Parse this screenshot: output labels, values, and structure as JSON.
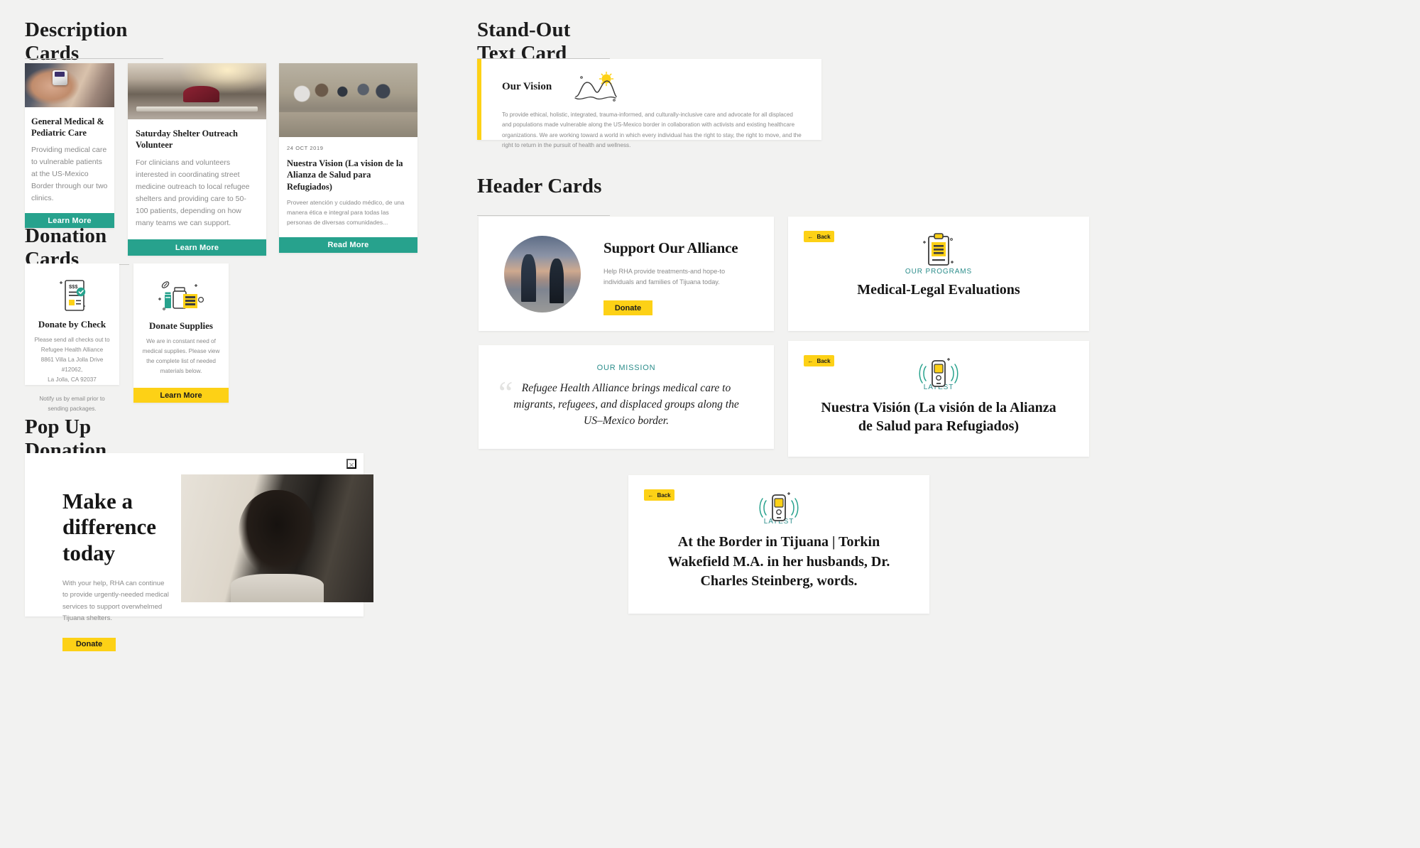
{
  "sections": {
    "description_cards": "Description Cards",
    "donation_cards": "Donation Cards",
    "pop_up_donation": "Pop Up Donation",
    "stand_out_text_card": "Stand-Out Text Card",
    "header_cards": "Header Cards"
  },
  "description": {
    "medical": {
      "title": "General Medical & Pediatric Care",
      "body": "Providing medical care to vulnerable patients at the US-Mexico Border through our two clinics.",
      "cta": "Learn More",
      "image": "oximeter-on-patient-hand-photo"
    },
    "shelter": {
      "title": "Saturday Shelter Outreach Volunteer",
      "body": "For clinicians and volunteers interested in coordinating street medicine outreach to local refugee shelters and providing care to 50-100 patients, depending on how many teams we can support.",
      "cta": "Learn More",
      "image": "shelter-supplies-tables-photo"
    },
    "vision_es": {
      "date": "24 OCT 2019",
      "title": "Nuestra Vision (La vision de la Alianza de Salud para Refugiados)",
      "body": "Proveer atención y cuidado médico, de una manera ética e integral para todas las personas de diversas comunidades...",
      "cta": "Read More",
      "image": "volunteer-group-photo"
    }
  },
  "donation": {
    "check": {
      "icon": "check-document-icon",
      "title": "Donate by Check",
      "line1": "Please send all checks out to",
      "line2": "Refugee Health Alliance",
      "line3": "8861 Villa La Jolla Drive #12062,",
      "line4": "La Jolla, CA 92037",
      "note": "Notify us by email prior to sending packages."
    },
    "supplies": {
      "icon": "medical-supplies-icon",
      "title": "Donate Supplies",
      "body": "We are in constant need of medical supplies. Please view the complete list of needed materials below.",
      "cta": "Learn More"
    }
  },
  "popup": {
    "close": "×",
    "heading": "Make a difference today",
    "body": "With your help, RHA can continue to provide urgently-needed medical services to support overwhelmed Tijuana shelters.",
    "cta": "Donate",
    "image": "person-portrait-photo"
  },
  "vision_card": {
    "title": "Our Vision",
    "icon": "mountain-sun-icon",
    "body": "To provide ethical, holistic, integrated, trauma-informed, and culturally-inclusive care and advocate for all displaced and populations made vulnerable along the US-Mexico border in collaboration with activists and existing healthcare organizations. We are working toward a world in which every individual has the right to stay, the right to move, and the right to return in the pursuit of health and wellness."
  },
  "header_cards": {
    "support": {
      "image": "couple-holding-hands-sunset-photo",
      "title": "Support Our Alliance",
      "body": "Help RHA provide treatments-and hope-to individuals and families of Tijuana today.",
      "cta": "Donate"
    },
    "programs": {
      "back": "Back",
      "back_icon": "arrow-left-icon",
      "icon": "clipboard-icon",
      "eyebrow": "OUR PROGRAMS",
      "title": "Medical-Legal Evaluations"
    },
    "mission": {
      "quote_mark": "“",
      "eyebrow": "OUR MISSION",
      "quote": "Refugee Health Alliance brings medical care to migrants, refugees, and displaced groups along the US–Mexico border."
    },
    "latest_es": {
      "back": "Back",
      "back_icon": "arrow-left-icon",
      "icon": "pager-device-icon",
      "eyebrow": "LATEST",
      "title": "Nuestra Visión (La visión de la Alianza de Salud para Refugiados)"
    },
    "latest_en": {
      "back": "Back",
      "back_icon": "arrow-left-icon",
      "icon": "pager-device-icon",
      "eyebrow": "LATEST",
      "title": "At the Border in Tijuana | Torkin Wakefield M.A. in her husbands, Dr. Charles Steinberg, words."
    }
  },
  "colors": {
    "teal": "#27a28d",
    "yellow": "#fdd116",
    "eyebrow_teal": "#2b8d8b",
    "background": "#f2f2f1",
    "text_dark": "#1c1c1c",
    "text_muted": "#8a8a8a"
  }
}
